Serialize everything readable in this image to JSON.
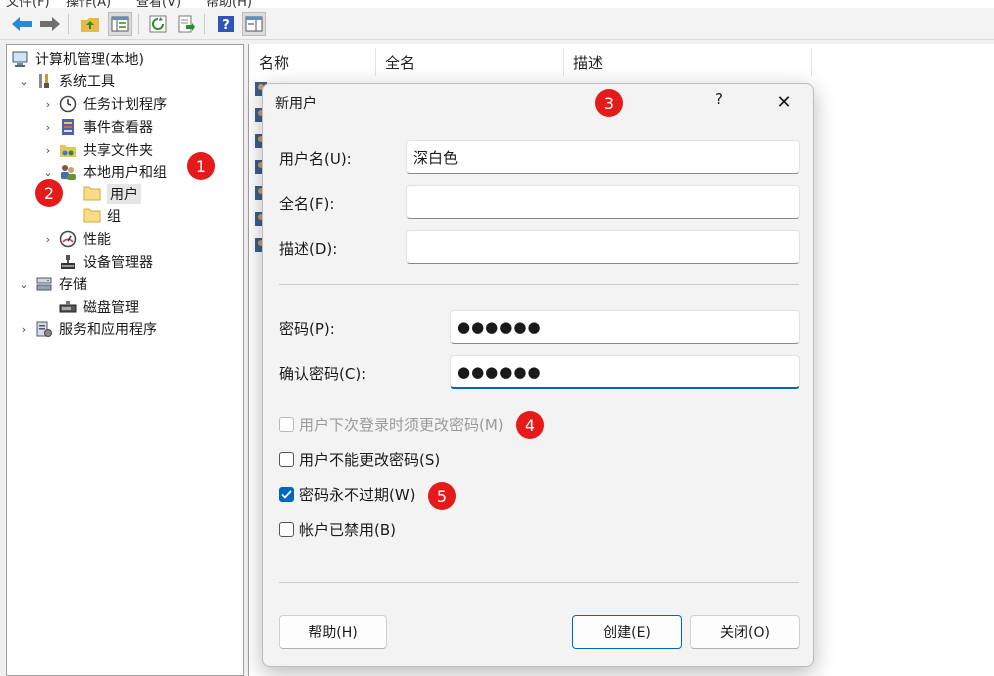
{
  "menubar": {
    "items": [
      "文件(F)",
      "操作(A)",
      "查看(V)",
      "帮助(H)"
    ]
  },
  "toolbar": {
    "buttons": [
      "back-arrow-icon",
      "forward-arrow-icon",
      "up-folder-icon",
      "show-hide-tree-icon",
      "refresh-icon",
      "export-list-icon",
      "help-icon",
      "action-pane-icon"
    ]
  },
  "tree": {
    "root": "计算机管理(本地)",
    "system_tools": "系统工具",
    "task_scheduler": "任务计划程序",
    "event_viewer": "事件查看器",
    "shared_folders": "共享文件夹",
    "local_users_groups": "本地用户和组",
    "users": "用户",
    "groups": "组",
    "performance": "性能",
    "device_manager": "设备管理器",
    "storage": "存储",
    "disk_management": "磁盘管理",
    "services_apps": "服务和应用程序"
  },
  "list": {
    "columns": [
      "名称",
      "全名",
      "描述"
    ]
  },
  "dialog": {
    "title": "新用户",
    "help_symbol": "?",
    "close_symbol": "✕",
    "username_label": "用户名(U):",
    "username_value": "深白色",
    "fullname_label": "全名(F):",
    "fullname_value": "",
    "description_label": "描述(D):",
    "description_value": "",
    "password_label": "密码(P):",
    "password_value": "●●●●●●",
    "confirm_label": "确认密码(C):",
    "confirm_value": "●●●●●●",
    "options": {
      "must_change": {
        "label": "用户下次登录时须更改密码(M)",
        "checked": false,
        "disabled": true
      },
      "cannot_change": {
        "label": "用户不能更改密码(S)",
        "checked": false,
        "disabled": false
      },
      "never_expires": {
        "label": "密码永不过期(W)",
        "checked": true,
        "disabled": false
      },
      "disabled_account": {
        "label": "帐户已禁用(B)",
        "checked": false,
        "disabled": false
      }
    },
    "help_button": "帮助(H)",
    "create_button": "创建(E)",
    "close_button": "关闭(O)"
  },
  "badges": [
    "1",
    "2",
    "3",
    "4",
    "5"
  ],
  "colors": {
    "accent": "#0067c0",
    "badge": "#e51a1a"
  }
}
